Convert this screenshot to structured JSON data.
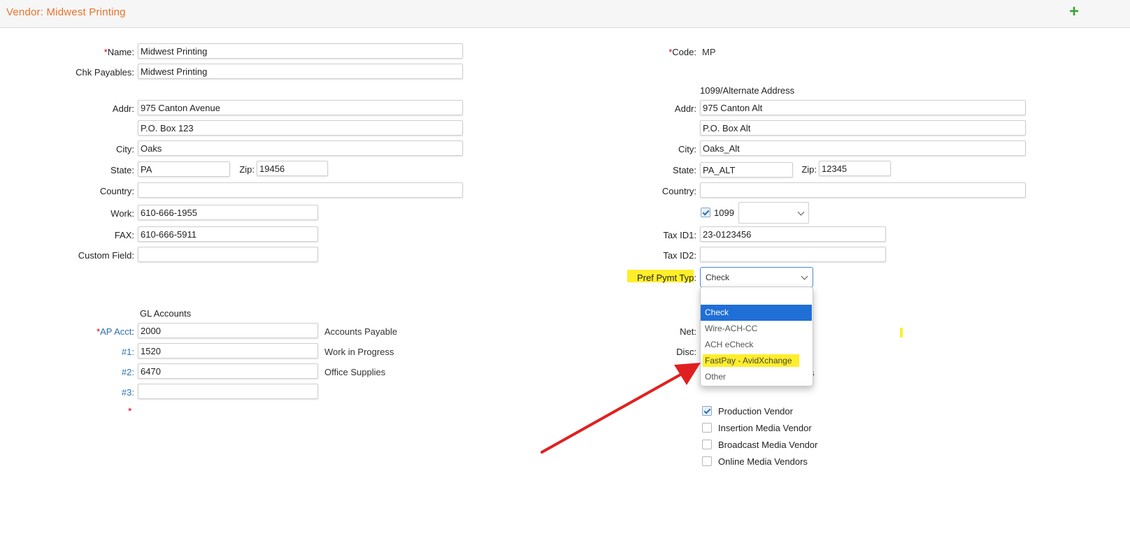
{
  "header": {
    "title": "Vendor: Midwest Printing",
    "add_label": "+"
  },
  "left": {
    "name": {
      "label": "Name:",
      "value": "Midwest Printing"
    },
    "chk_payables": {
      "label": "Chk Payables:",
      "value": "Midwest Printing"
    },
    "addr": {
      "label": "Addr:",
      "line1": "975 Canton Avenue",
      "line2": "P.O. Box 123"
    },
    "city": {
      "label": "City:",
      "value": "Oaks"
    },
    "state": {
      "label": "State:",
      "value": "PA"
    },
    "zip": {
      "label": "Zip:",
      "value": "19456"
    },
    "country": {
      "label": "Country:",
      "value": ""
    },
    "work": {
      "label": "Work:",
      "value": "610-666-1955"
    },
    "fax": {
      "label": "FAX:",
      "value": "610-666-5911"
    },
    "custom": {
      "label": "Custom Field:",
      "value": ""
    }
  },
  "gl": {
    "header": "GL Accounts",
    "ap": {
      "label": "AP Acct",
      "colon": ":",
      "value": "2000",
      "desc": "Accounts Payable"
    },
    "acct1": {
      "label": "#1:",
      "value": "1520",
      "desc": "Work in Progress"
    },
    "acct2": {
      "label": "#2:",
      "value": "6470",
      "desc": "Office Supplies"
    },
    "acct3": {
      "label": "#3:",
      "value": "",
      "desc": ""
    },
    "required_mark": "*"
  },
  "right": {
    "code": {
      "label": "Code:",
      "value": "MP"
    },
    "alt_header": "1099/Alternate Address",
    "addr": {
      "label": "Addr:",
      "line1": "975 Canton Alt",
      "line2": "P.O. Box Alt"
    },
    "city": {
      "label": "City:",
      "value": "Oaks_Alt"
    },
    "state": {
      "label": "State:",
      "value": "PA_ALT"
    },
    "zip": {
      "label": "Zip:",
      "value": "12345"
    },
    "country": {
      "label": "Country:",
      "value": ""
    },
    "ten99": {
      "label": "1099",
      "checked": true,
      "select_value": ""
    },
    "tax1": {
      "label": "Tax ID1:",
      "value": "23-0123456"
    },
    "tax2": {
      "label": "Tax ID2:",
      "value": ""
    },
    "pref": {
      "label": "Pref Pymt Typ:",
      "value": "Check"
    },
    "net": {
      "label": "Net:"
    },
    "disc": {
      "label": "Disc:"
    },
    "hidden_fragment": "s"
  },
  "dropdown": {
    "options": [
      "",
      "Check",
      "Wire-ACH-CC",
      "ACH eCheck",
      "FastPay - AvidXchange",
      "Other"
    ],
    "selected_index": 1,
    "highlighted_index": 4
  },
  "vendor_types": [
    {
      "label": "Production Vendor",
      "checked": true
    },
    {
      "label": "Insertion Media Vendor",
      "checked": false
    },
    {
      "label": "Broadcast Media Vendor",
      "checked": false
    },
    {
      "label": "Online Media Vendors",
      "checked": false
    }
  ],
  "colors": {
    "title": "#e8732c",
    "required": "#d0021b",
    "link": "#2a6fb0",
    "dropdown_active": "#1f6fd6",
    "highlight": "#ffee2a",
    "arrow": "#e02020",
    "add_icon": "#3aa33a"
  }
}
